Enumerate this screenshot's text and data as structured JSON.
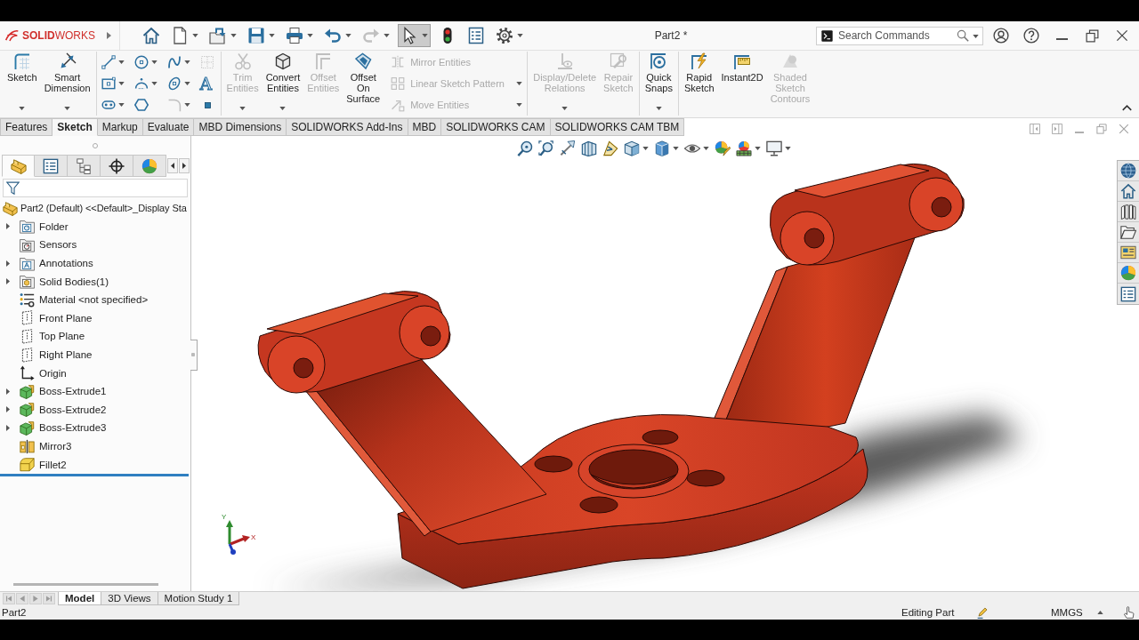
{
  "title_bar": {
    "logo": "**SOLID**WORKS",
    "quick_access": [
      {
        "dropdown": false,
        "disabled": false,
        "selected": false
      },
      {
        "dropdown": true,
        "disabled": false,
        "selected": false
      },
      {
        "dropdown": true,
        "disabled": false,
        "selected": false
      },
      {
        "dropdown": true,
        "disabled": false,
        "selected": false
      },
      {
        "dropdown": true,
        "disabled": false,
        "selected": false
      },
      {
        "dropdown": true,
        "disabled": false,
        "selected": false
      },
      {
        "dropdown": true,
        "disabled": true,
        "selected": false
      },
      {
        "dropdown": true,
        "disabled": false,
        "selected": true
      },
      {
        "dropdown": false,
        "disabled": false,
        "selected": false
      },
      {
        "dropdown": false,
        "disabled": false,
        "selected": false
      },
      {
        "dropdown": true,
        "disabled": false,
        "selected": false
      }
    ],
    "document_title": "Part2 *",
    "search": {
      "placeholder": "Search Commands"
    }
  },
  "ribbon": [
    {
      "items": [
        {
          "kind": "large",
          "label": "Sketch",
          "dropdown": true,
          "disabled": false
        },
        {
          "kind": "large",
          "label": "Smart Dimension",
          "dropdown": true,
          "disabled": false
        }
      ]
    },
    {
      "items": [
        {
          "kind": "small",
          "dropdown": true,
          "disabled": false
        },
        {
          "kind": "small",
          "dropdown": true,
          "disabled": false
        },
        {
          "kind": "small",
          "dropdown": true,
          "disabled": false
        },
        {
          "kind": "small",
          "dropdown": false,
          "disabled": true
        },
        {
          "kind": "small",
          "dropdown": true,
          "disabled": false
        },
        {
          "kind": "small",
          "dropdown": true,
          "disabled": false
        },
        {
          "kind": "small",
          "dropdown": true,
          "disabled": false
        },
        {
          "kind": "small",
          "glyph": "A",
          "dropdown": false,
          "disabled": false
        },
        {
          "kind": "small",
          "dropdown": true,
          "disabled": false
        },
        {
          "kind": "small",
          "dropdown": false,
          "disabled": false
        },
        {
          "kind": "small",
          "dropdown": true,
          "disabled": true
        },
        {
          "kind": "small",
          "dropdown": false,
          "disabled": false
        }
      ]
    },
    {
      "items": [
        {
          "kind": "large",
          "label": "Trim Entities",
          "dropdown": true,
          "disabled": true
        },
        {
          "kind": "large",
          "label": "Convert Entities",
          "dropdown": true,
          "disabled": false
        },
        {
          "kind": "large",
          "label": "Offset Entities",
          "dropdown": false,
          "disabled": true
        },
        {
          "kind": "large",
          "label": "Offset On Surface",
          "dropdown": false,
          "disabled": false
        },
        {
          "kind": "list",
          "label": "Mirror Entities",
          "dropdown": false,
          "disabled": true
        },
        {
          "kind": "list",
          "label": "Linear Sketch Pattern",
          "dropdown": true,
          "disabled": true
        },
        {
          "kind": "list",
          "label": "Move Entities",
          "dropdown": true,
          "disabled": true
        }
      ]
    },
    {
      "items": [
        {
          "kind": "large",
          "label": "Display/Delete Relations",
          "dropdown": true,
          "disabled": true
        },
        {
          "kind": "large",
          "label": "Repair Sketch",
          "dropdown": false,
          "disabled": true
        }
      ]
    },
    {
      "items": [
        {
          "kind": "large",
          "label": "Quick Snaps",
          "dropdown": true,
          "disabled": false
        }
      ]
    },
    {
      "items": [
        {
          "kind": "large",
          "label": "Rapid Sketch",
          "dropdown": false,
          "disabled": false
        },
        {
          "kind": "large",
          "label": "Instant2D",
          "dropdown": false,
          "disabled": false
        },
        {
          "kind": "large",
          "label": "Shaded Sketch Contours",
          "dropdown": false,
          "disabled": true
        }
      ]
    }
  ],
  "command_tabs": [
    {
      "label": "Features",
      "selected": false
    },
    {
      "label": "Sketch",
      "selected": true
    },
    {
      "label": "Markup",
      "selected": false
    },
    {
      "label": "Evaluate",
      "selected": false
    },
    {
      "label": "MBD Dimensions",
      "selected": false
    },
    {
      "label": "SOLIDWORKS Add-Ins",
      "selected": false
    },
    {
      "label": "MBD",
      "selected": false
    },
    {
      "label": "SOLIDWORKS CAM",
      "selected": false
    },
    {
      "label": "SOLIDWORKS CAM TBM",
      "selected": false
    }
  ],
  "feature_manager": {
    "panel_tabs": [
      {
        "selected": true
      },
      {
        "selected": false
      },
      {
        "selected": false
      },
      {
        "selected": false
      },
      {
        "selected": false
      }
    ],
    "root": "Part2 (Default) <<Default>_Display Sta",
    "items": [
      {
        "label": "Folder",
        "expandable": true
      },
      {
        "label": "Sensors",
        "expandable": false
      },
      {
        "label": "Annotations",
        "expandable": true
      },
      {
        "label": "Solid Bodies(1)",
        "expandable": true
      },
      {
        "label": "Material <not specified>",
        "expandable": false
      },
      {
        "label": "Front Plane",
        "expandable": false
      },
      {
        "label": "Top Plane",
        "expandable": false
      },
      {
        "label": "Right Plane",
        "expandable": false
      },
      {
        "label": "Origin",
        "expandable": false
      },
      {
        "label": "Boss-Extrude1",
        "expandable": true
      },
      {
        "label": "Boss-Extrude2",
        "expandable": true
      },
      {
        "label": "Boss-Extrude3",
        "expandable": true
      },
      {
        "label": "Mirror3",
        "expandable": false
      },
      {
        "label": "Fillet2",
        "expandable": false
      }
    ]
  },
  "graphics_area": {
    "triad_labels": [
      "Y",
      "X"
    ]
  },
  "bottom_tabs": [
    {
      "label": "Model",
      "selected": true
    },
    {
      "label": "3D Views",
      "selected": false
    },
    {
      "label": "Motion Study 1",
      "selected": false
    }
  ],
  "status_bar": {
    "document": "Part2",
    "mode": "Editing Part",
    "units": "MMGS"
  }
}
